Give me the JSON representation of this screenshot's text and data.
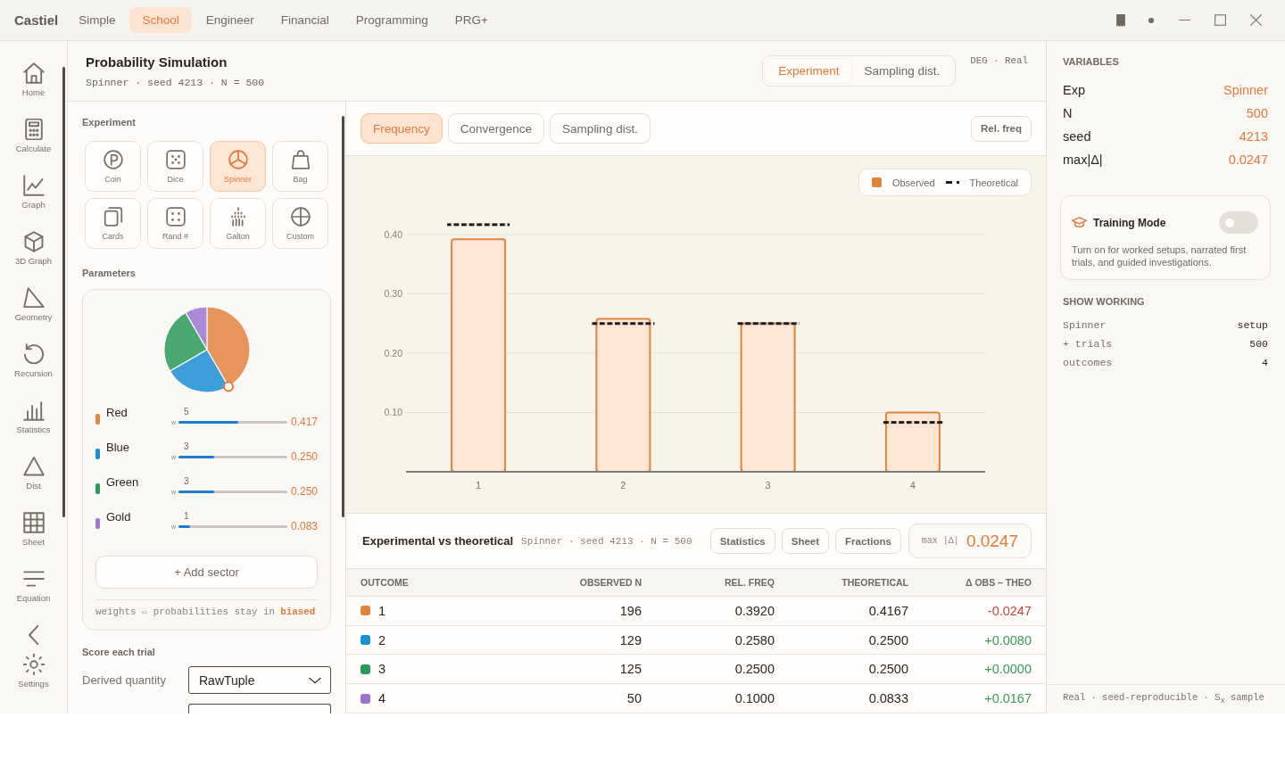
{
  "app": {
    "name": "Castiel"
  },
  "mode_tabs": [
    {
      "label": "Simple",
      "selected": false
    },
    {
      "label": "School",
      "selected": true
    },
    {
      "label": "Engineer",
      "selected": false
    },
    {
      "label": "Financial",
      "selected": false
    },
    {
      "label": "Programming",
      "selected": false
    },
    {
      "label": "PRG+",
      "selected": false
    }
  ],
  "nav": {
    "items": [
      {
        "label": "Home"
      },
      {
        "label": "Calculate"
      },
      {
        "label": "Graph"
      },
      {
        "label": "3D Graph"
      },
      {
        "label": "Geometry"
      },
      {
        "label": "Recursion"
      },
      {
        "label": "Statistics"
      },
      {
        "label": "Dist"
      },
      {
        "label": "Sheet"
      },
      {
        "label": "Equation"
      }
    ],
    "settings": {
      "label": "Settings"
    }
  },
  "header": {
    "title": "Probability Simulation",
    "subtitle": "Spinner · seed 4213 · N = 500",
    "view_toggle": [
      {
        "label": "Experiment",
        "selected": true
      },
      {
        "label": "Sampling dist.",
        "selected": false
      }
    ],
    "status": "DEG · Real"
  },
  "experiment_panel": {
    "section_label": "Experiment",
    "experiments": [
      {
        "label": "Coin",
        "selected": false
      },
      {
        "label": "Dice",
        "selected": false
      },
      {
        "label": "Spinner",
        "selected": true
      },
      {
        "label": "Bag",
        "selected": false
      },
      {
        "label": "Cards",
        "selected": false
      },
      {
        "label": "Rand #",
        "selected": false
      },
      {
        "label": "Galton",
        "selected": false
      },
      {
        "label": "Custom",
        "selected": false
      }
    ],
    "parameters_label": "Parameters",
    "sectors": [
      {
        "name": "Red",
        "color": "#e3843f",
        "weight": "5",
        "weight_label": "w",
        "level": 0.55,
        "probability": "0.417"
      },
      {
        "name": "Blue",
        "color": "#1a8fd6",
        "weight": "3",
        "weight_label": "w",
        "level": 0.33,
        "probability": "0.250"
      },
      {
        "name": "Green",
        "color": "#2a9a5c",
        "weight": "3",
        "weight_label": "w",
        "level": 0.33,
        "probability": "0.250"
      },
      {
        "name": "Gold",
        "color": "#9c76d0",
        "weight": "1",
        "weight_label": "w",
        "level": 0.11,
        "probability": "0.083"
      }
    ],
    "add_button": "+ Add sector",
    "footnote": "weights ⇔ probabilities stay in **biased**",
    "score_label": "Score each trial",
    "fields": [
      {
        "kind": "dropdown",
        "label": "Derived quantity",
        "value": "RawTuple"
      },
      {
        "kind": "partial_dropdown"
      }
    ]
  },
  "chart_tabs": [
    {
      "label": "Frequency",
      "selected": true
    },
    {
      "label": "Convergence",
      "selected": false
    },
    {
      "label": "Sampling dist.",
      "selected": false
    }
  ],
  "scale_button": "Rel. freq",
  "chart": {
    "chart_data": {
      "type": "bar",
      "categories": [
        "1",
        "2",
        "3",
        "4"
      ],
      "series": [
        {
          "name": "Observed",
          "color": "#e0843c",
          "values": [
            0.392,
            0.258,
            0.25,
            0.1
          ]
        }
      ],
      "ylim": [
        0,
        0.4
      ],
      "yticks": [
        {
          "value": 0.1,
          "label": "0.10"
        },
        {
          "value": 0.2,
          "label": "0.20"
        },
        {
          "value": 0.3,
          "label": "0.30"
        },
        {
          "value": 0.4,
          "label": "0.40"
        }
      ],
      "grid": true
    },
    "reference": {
      "name": "Theoretical",
      "color": "#1f1d1b"
    }
  },
  "results": {
    "title": "Experimental vs theoretical",
    "subtitle": "Spinner · seed 4213 · N = 500",
    "buttons": [
      "Statistics",
      "Sheet",
      "Fractions"
    ],
    "max_delta": {
      "label": "max |Δ|",
      "value": "0.0247"
    }
  },
  "table": {
    "columns": [
      "OUTCOME",
      "OBSERVED N",
      "REL. FREQ",
      "THEORETICAL",
      "Δ OBS – THEO"
    ],
    "rows": [
      {
        "outcome": "1",
        "color": "#e0843c",
        "observed_n": "196",
        "rel_freq": "0.3920",
        "theoretical": "0.4167",
        "delta": "-0.0247",
        "negative": true
      },
      {
        "outcome": "2",
        "color": "#1a90d0",
        "observed_n": "129",
        "rel_freq": "0.2580",
        "theoretical": "0.2500",
        "delta": "+0.0080",
        "negative": false
      },
      {
        "outcome": "3",
        "color": "#2a9a5a",
        "observed_n": "125",
        "rel_freq": "0.2500",
        "theoretical": "0.2500",
        "delta": "+0.0000",
        "negative": false
      },
      {
        "outcome": "4",
        "color": "#9b72cc",
        "observed_n": "50",
        "rel_freq": "0.1000",
        "theoretical": "0.0833",
        "delta": "+0.0167",
        "negative": false
      }
    ]
  },
  "variables": {
    "title": "VARIABLES",
    "rows": [
      {
        "name": "Exp",
        "value": "Spinner"
      },
      {
        "name": "N",
        "value": "500"
      },
      {
        "name": "seed",
        "value": "4213"
      },
      {
        "name": "max|Δ|",
        "value": "0.0247"
      }
    ]
  },
  "training": {
    "title": "Training Mode",
    "on": false,
    "description": "Turn on for worked setups, narrated first trials, and guided investigations."
  },
  "show_working": {
    "title": "SHOW WORKING",
    "rows": [
      {
        "label": "Spinner",
        "value": "setup"
      },
      {
        "label": "+ trials",
        "value": "500"
      },
      {
        "label": "outcomes",
        "value": "4"
      }
    ]
  },
  "footer": "Real · seed-reproducible · S$_{x}$ sample"
}
